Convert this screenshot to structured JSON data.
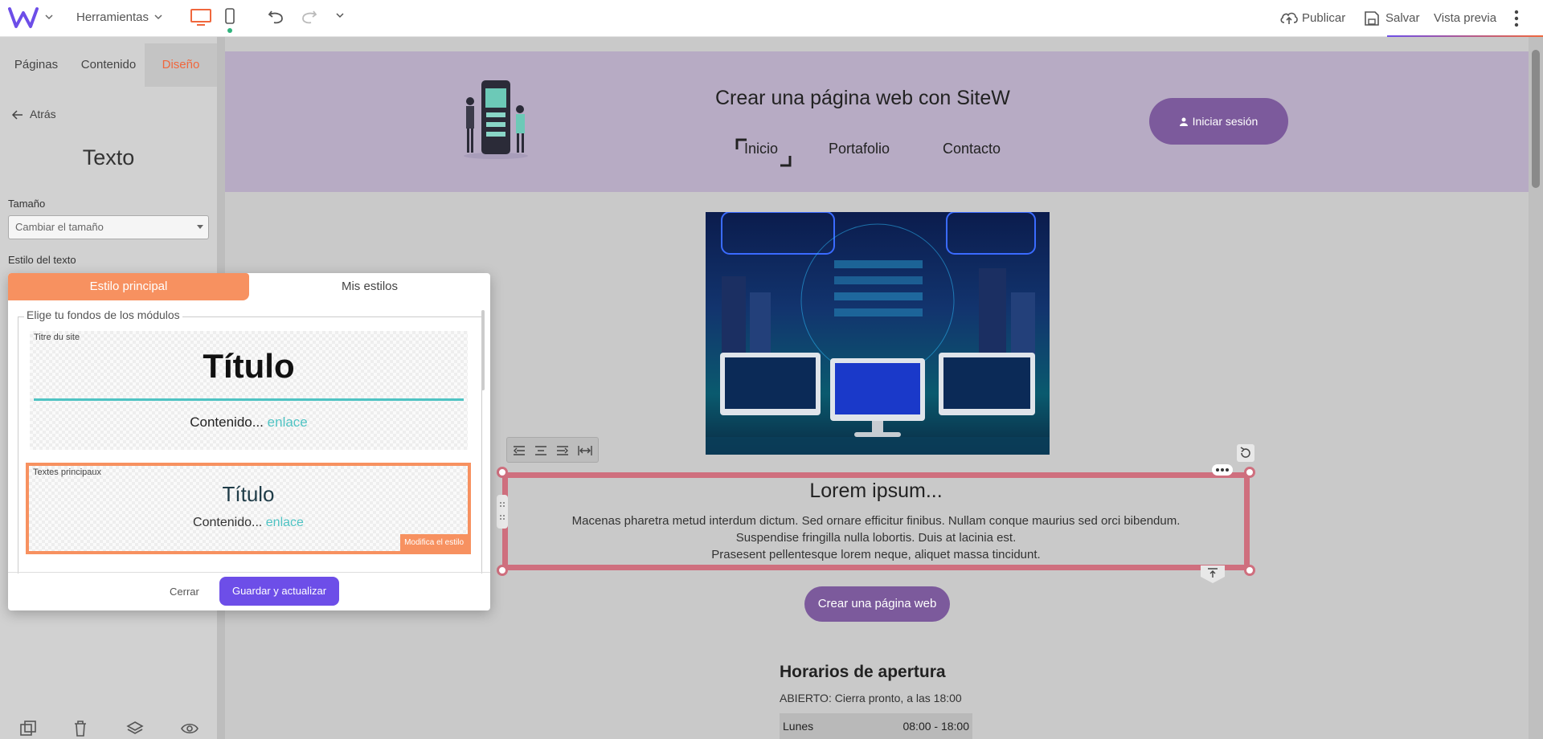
{
  "topbar": {
    "tools_label": "Herramientas",
    "publish_label": "Publicar",
    "save_label": "Salvar",
    "preview_label": "Vista previa"
  },
  "sidebar": {
    "tabs": [
      {
        "label": "Páginas"
      },
      {
        "label": "Contenido"
      },
      {
        "label": "Diseño",
        "active": true
      }
    ],
    "back_label": "Atrás",
    "panel_title": "Texto",
    "size_label": "Tamaño",
    "size_select_value": "Cambiar el tamaño",
    "text_style_label": "Estilo del texto"
  },
  "modal": {
    "tab_main": "Estilo principal",
    "tab_my": "Mis estilos",
    "legend": "Elige tu fondos de los módulos",
    "card1": {
      "label": "Titre du site",
      "title": "Título",
      "content": "Contenido...",
      "link": "enlace"
    },
    "card2": {
      "label": "Textes principaux",
      "title": "Título",
      "content": "Contenido...",
      "link": "enlace",
      "modify": "Modifica el estilo"
    },
    "close_label": "Cerrar",
    "save_update_label": "Guardar y actualizar"
  },
  "site": {
    "title": "Crear una página web con SiteW",
    "nav": [
      "Inicio",
      "Portafolio",
      "Contacto"
    ],
    "login_label": "Iniciar sesión",
    "text_block": {
      "heading": "Lorem ipsum...",
      "lines": [
        "Macenas pharetra metud interdum dictum. Sed ornare efficitur finibus. Nullam conque maurius sed orci bibendum.",
        "Suspendise fringilla nulla lobortis. Duis at lacinia est.",
        "Prasesent pellentesque lorem neque, aliquet massa tincidunt."
      ]
    },
    "cta_label": "Crear una página web",
    "hours": {
      "title": "Horarios de apertura",
      "status": "ABIERTO: Cierra pronto, a las 18:00",
      "rows": [
        {
          "day": "Lunes",
          "time": "08:00 - 18:00"
        }
      ]
    }
  },
  "colors": {
    "accent_orange": "#f0673d",
    "purple": "#6d4ee8",
    "site_purple": "#7c5a9c",
    "teal": "#4fc3c3",
    "selection_pink": "#cf6f7e"
  }
}
